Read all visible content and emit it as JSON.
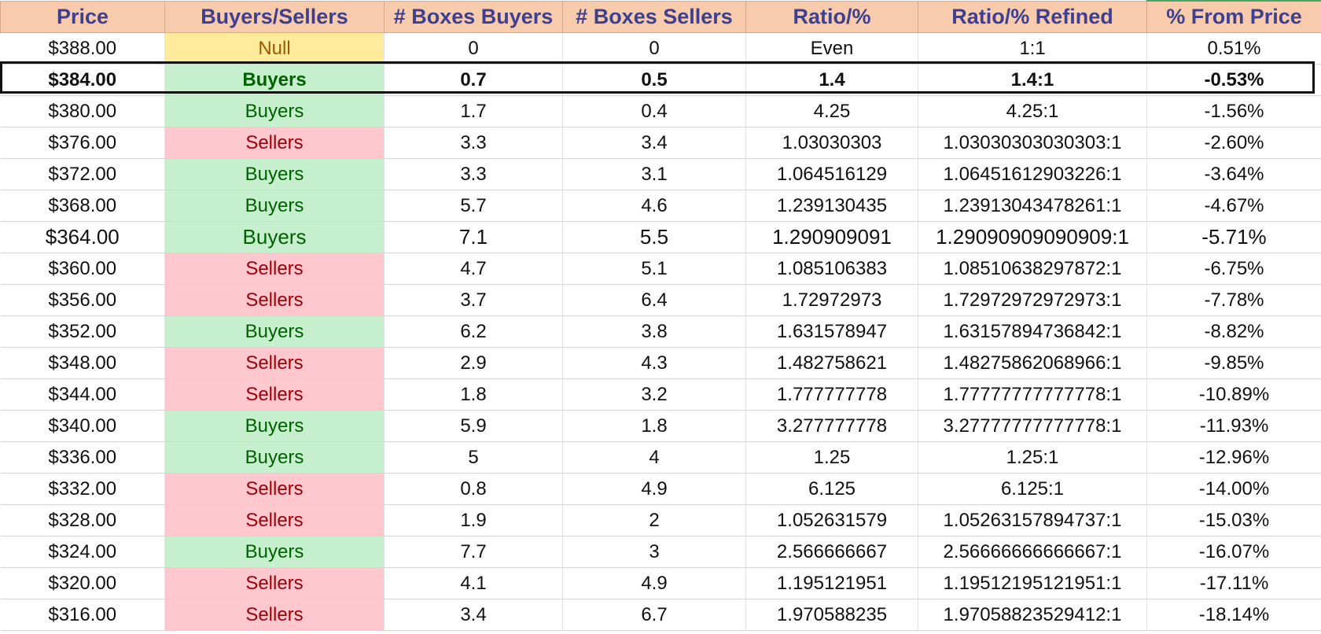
{
  "headers": [
    "Price",
    "Buyers/Sellers",
    "# Boxes Buyers",
    "# Boxes Sellers",
    "Ratio/%",
    "Ratio/% Refined",
    "% From Price"
  ],
  "rows": [
    {
      "price": "$388.00",
      "bs": "Null",
      "buyers": "0",
      "sellers": "0",
      "ratio": "Even",
      "refined": "1:1",
      "pct": "0.51%"
    },
    {
      "price": "$384.00",
      "bs": "Buyers",
      "buyers": "0.7",
      "sellers": "0.5",
      "ratio": "1.4",
      "refined": "1.4:1",
      "pct": "-0.53%"
    },
    {
      "price": "$380.00",
      "bs": "Buyers",
      "buyers": "1.7",
      "sellers": "0.4",
      "ratio": "4.25",
      "refined": "4.25:1",
      "pct": "-1.56%"
    },
    {
      "price": "$376.00",
      "bs": "Sellers",
      "buyers": "3.3",
      "sellers": "3.4",
      "ratio": "1.03030303",
      "refined": "1.03030303030303:1",
      "pct": "-2.60%"
    },
    {
      "price": "$372.00",
      "bs": "Buyers",
      "buyers": "3.3",
      "sellers": "3.1",
      "ratio": "1.064516129",
      "refined": "1.06451612903226:1",
      "pct": "-3.64%"
    },
    {
      "price": "$368.00",
      "bs": "Buyers",
      "buyers": "5.7",
      "sellers": "4.6",
      "ratio": "1.239130435",
      "refined": "1.23913043478261:1",
      "pct": "-4.67%"
    },
    {
      "price": "$364.00",
      "bs": "Buyers",
      "buyers": "7.1",
      "sellers": "5.5",
      "ratio": "1.290909091",
      "refined": "1.29090909090909:1",
      "pct": "-5.71%"
    },
    {
      "price": "$360.00",
      "bs": "Sellers",
      "buyers": "4.7",
      "sellers": "5.1",
      "ratio": "1.085106383",
      "refined": "1.08510638297872:1",
      "pct": "-6.75%"
    },
    {
      "price": "$356.00",
      "bs": "Sellers",
      "buyers": "3.7",
      "sellers": "6.4",
      "ratio": "1.72972973",
      "refined": "1.72972972972973:1",
      "pct": "-7.78%"
    },
    {
      "price": "$352.00",
      "bs": "Buyers",
      "buyers": "6.2",
      "sellers": "3.8",
      "ratio": "1.631578947",
      "refined": "1.63157894736842:1",
      "pct": "-8.82%"
    },
    {
      "price": "$348.00",
      "bs": "Sellers",
      "buyers": "2.9",
      "sellers": "4.3",
      "ratio": "1.482758621",
      "refined": "1.48275862068966:1",
      "pct": "-9.85%"
    },
    {
      "price": "$344.00",
      "bs": "Sellers",
      "buyers": "1.8",
      "sellers": "3.2",
      "ratio": "1.777777778",
      "refined": "1.77777777777778:1",
      "pct": "-10.89%"
    },
    {
      "price": "$340.00",
      "bs": "Buyers",
      "buyers": "5.9",
      "sellers": "1.8",
      "ratio": "3.277777778",
      "refined": "3.27777777777778:1",
      "pct": "-11.93%"
    },
    {
      "price": "$336.00",
      "bs": "Buyers",
      "buyers": "5",
      "sellers": "4",
      "ratio": "1.25",
      "refined": "1.25:1",
      "pct": "-12.96%"
    },
    {
      "price": "$332.00",
      "bs": "Sellers",
      "buyers": "0.8",
      "sellers": "4.9",
      "ratio": "6.125",
      "refined": "6.125:1",
      "pct": "-14.00%"
    },
    {
      "price": "$328.00",
      "bs": "Sellers",
      "buyers": "1.9",
      "sellers": "2",
      "ratio": "1.052631579",
      "refined": "1.05263157894737:1",
      "pct": "-15.03%"
    },
    {
      "price": "$324.00",
      "bs": "Buyers",
      "buyers": "7.7",
      "sellers": "3",
      "ratio": "2.566666667",
      "refined": "2.56666666666667:1",
      "pct": "-16.07%"
    },
    {
      "price": "$320.00",
      "bs": "Sellers",
      "buyers": "4.1",
      "sellers": "4.9",
      "ratio": "1.195121951",
      "refined": "1.19512195121951:1",
      "pct": "-17.11%"
    },
    {
      "price": "$316.00",
      "bs": "Sellers",
      "buyers": "3.4",
      "sellers": "6.7",
      "ratio": "1.970588235",
      "refined": "1.97058823529412:1",
      "pct": "-18.14%"
    }
  ],
  "colors": {
    "header_bg": "#f8cbad",
    "header_text": "#3e3f8e",
    "buyers_bg": "#c6efce",
    "buyers_text": "#006100",
    "sellers_bg": "#ffc7ce",
    "sellers_text": "#9c0006",
    "null_bg": "#ffeb9c",
    "null_text": "#9c5700"
  }
}
